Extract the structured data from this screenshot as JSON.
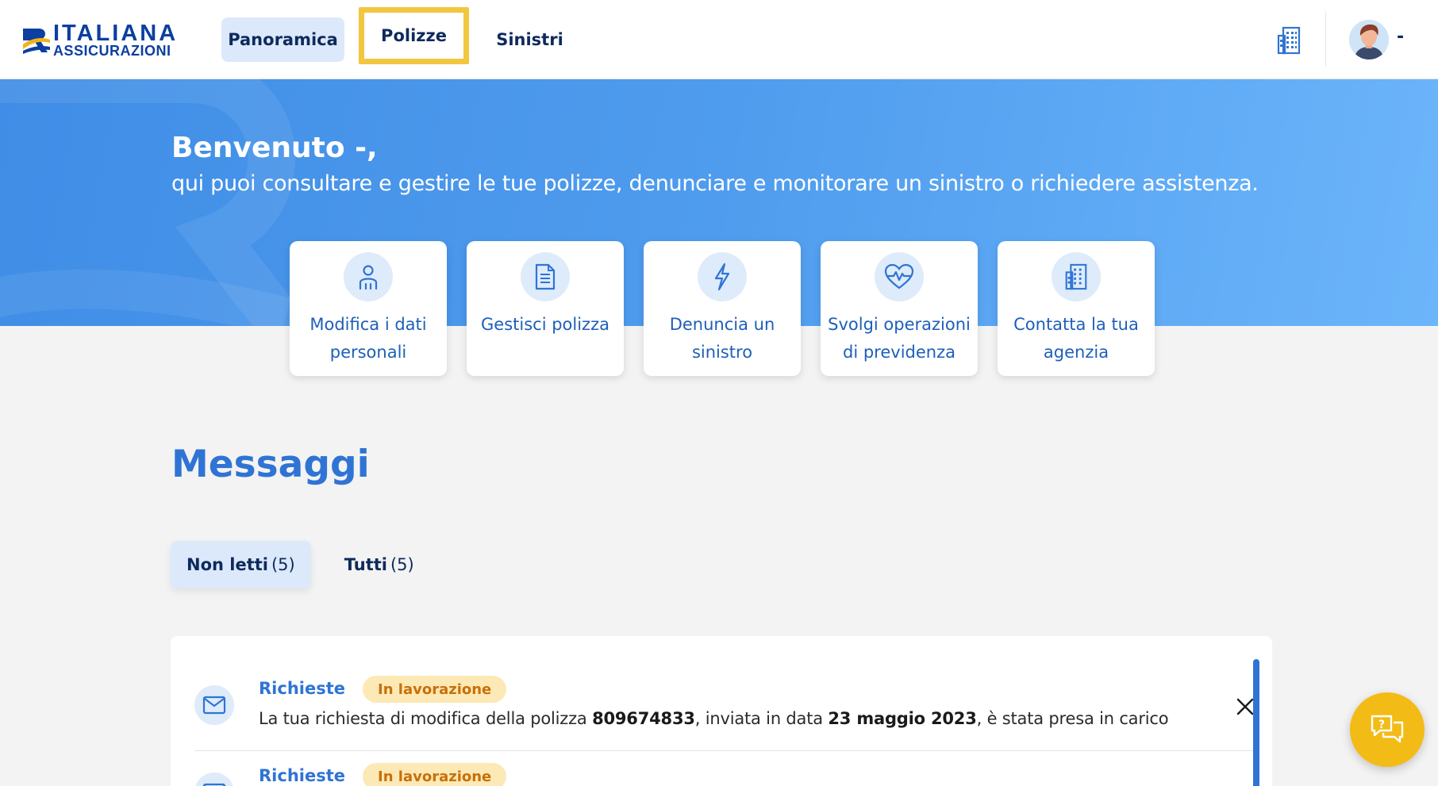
{
  "header": {
    "logo": {
      "line1": "ITALIANA",
      "line2": "ASSICURAZIONI"
    },
    "nav": [
      {
        "label": "Panoramica",
        "state": "active"
      },
      {
        "label": "Polizze",
        "state": "focused"
      },
      {
        "label": "Sinistri",
        "state": "default"
      }
    ],
    "icons": {
      "agency": "building-icon",
      "user": "avatar"
    },
    "user_name": "-"
  },
  "hero": {
    "welcome": "Benvenuto -,",
    "subtitle": "qui puoi consultare e gestire le tue polizze, denunciare e monitorare un sinistro o richiedere assistenza.",
    "actions": [
      {
        "label": "Modifica i dati personali",
        "icon": "person-icon"
      },
      {
        "label": "Gestisci polizza",
        "icon": "document-icon"
      },
      {
        "label": "Denuncia un sinistro",
        "icon": "lightning-icon"
      },
      {
        "label": "Svolgi operazioni di previdenza",
        "icon": "heart-pulse-icon"
      },
      {
        "label": "Contatta la tua agenzia",
        "icon": "building-icon"
      }
    ]
  },
  "messages": {
    "title": "Messaggi",
    "tabs": [
      {
        "label": "Non letti",
        "count": "(5)",
        "active": true
      },
      {
        "label": "Tutti",
        "count": "(5)",
        "active": false
      }
    ],
    "items": [
      {
        "category": "Richieste",
        "status": "In lavorazione",
        "text_parts": [
          "La tua richiesta di modifica della polizza ",
          "809674833",
          ", inviata in data ",
          "23 maggio 2023",
          ", è stata presa in carico"
        ]
      },
      {
        "category": "Richieste",
        "status": "In lavorazione",
        "text_parts": [
          "",
          "",
          "",
          "",
          ""
        ]
      }
    ]
  },
  "colors": {
    "brand_blue": "#2f74d4",
    "nav_active_bg": "#dbe9fb",
    "focus_outline": "#f2c63f",
    "badge_bg": "#fde9b5",
    "badge_text": "#c8700a",
    "chat_fab": "#f3bb16"
  },
  "chat": {
    "icon": "chat-bubbles-icon"
  }
}
